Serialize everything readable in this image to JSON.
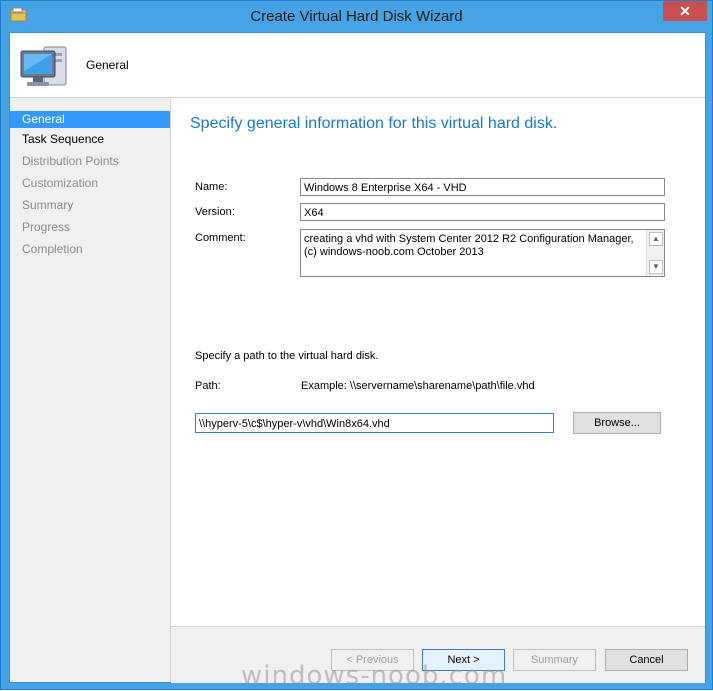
{
  "window": {
    "title": "Create Virtual Hard Disk Wizard",
    "close_glyph": "✕"
  },
  "header": {
    "title": "General",
    "icon": "computer-icon"
  },
  "nav": {
    "items": [
      {
        "label": "General",
        "state": "selected"
      },
      {
        "label": "Task Sequence",
        "state": "enabled"
      },
      {
        "label": "Distribution Points",
        "state": "disabled"
      },
      {
        "label": "Customization",
        "state": "disabled"
      },
      {
        "label": "Summary",
        "state": "disabled"
      },
      {
        "label": "Progress",
        "state": "disabled"
      },
      {
        "label": "Completion",
        "state": "disabled"
      }
    ]
  },
  "main": {
    "heading": "Specify general information for this virtual hard disk.",
    "name_label": "Name:",
    "name_value": "Windows 8 Enterprise X64 - VHD",
    "version_label": "Version:",
    "version_value": "X64",
    "comment_label": "Comment:",
    "comment_value": "creating a vhd with System Center 2012 R2 Configuration Manager, (c) windows-noob.com October 2013",
    "path_instruction": "Specify a path to the virtual hard disk.",
    "path_label": "Path:",
    "path_example": "Example: \\\\servername\\sharename\\path\\file.vhd",
    "path_value": "\\\\hyperv-5\\c$\\hyper-v\\vhd\\Win8x64.vhd",
    "browse_label": "Browse..."
  },
  "footer": {
    "previous_label": "< Previous",
    "next_label": "Next >",
    "summary_label": "Summary",
    "cancel_label": "Cancel"
  },
  "watermark": "windows-noob.com",
  "colors": {
    "accent": "#46a3e6",
    "selection": "#3399ff",
    "heading": "#1979c8",
    "close": "#c75050"
  }
}
